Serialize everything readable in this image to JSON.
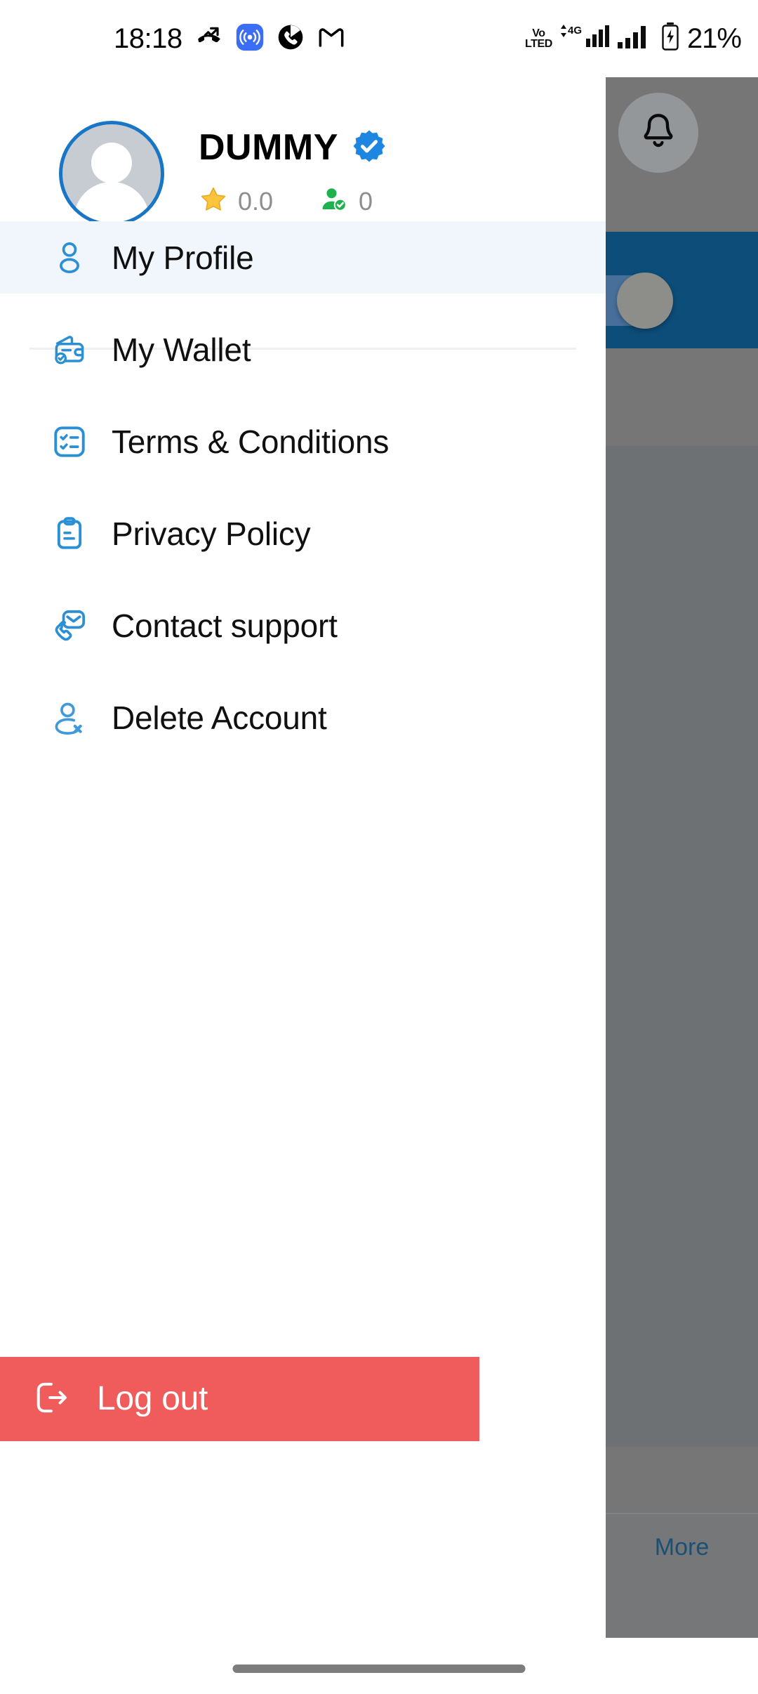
{
  "status_bar": {
    "time": "18:18",
    "icons_left": [
      "missed-call-icon",
      "nearby-share-icon",
      "call-app-icon",
      "gmail-icon"
    ],
    "volte_line1": "Vo",
    "volte_line2": "LTE",
    "volte_suffix": "D",
    "network_type": "4G",
    "battery_percent": "21%"
  },
  "profile": {
    "name": "DUMMY",
    "verified": true,
    "rating_value": "0.0",
    "referrals_value": "0",
    "rating_icon": "star-icon",
    "referrals_icon": "user-check-icon",
    "avatar_icon": "avatar-placeholder-icon"
  },
  "menu": {
    "items": [
      {
        "label": "My Profile",
        "icon": "user-icon",
        "active": true
      },
      {
        "label": "My Wallet",
        "icon": "wallet-icon",
        "active": false
      },
      {
        "label": "Terms & Conditions",
        "icon": "checklist-icon",
        "active": false
      },
      {
        "label": "Privacy Policy",
        "icon": "clipboard-icon",
        "active": false
      },
      {
        "label": "Contact support",
        "icon": "phone-message-icon",
        "active": false
      },
      {
        "label": "Delete Account",
        "icon": "user-remove-icon",
        "active": false
      }
    ]
  },
  "logout": {
    "label": "Log out",
    "icon": "logout-arrow-icon",
    "background_color": "#f05b5b"
  },
  "background_app": {
    "bell_icon": "notification-bell-icon",
    "toggle_icon": "toggle-switch-icon",
    "more_label": "More",
    "more_icon": "three-dots-vertical-icon",
    "accent_color": "#1b5074",
    "banner_color": "#0c4d79"
  },
  "theme": {
    "accent_blue": "#1976c7",
    "active_row_bg": "#f1f6fd",
    "danger_red": "#f05b5b",
    "scrim": "#767676"
  }
}
